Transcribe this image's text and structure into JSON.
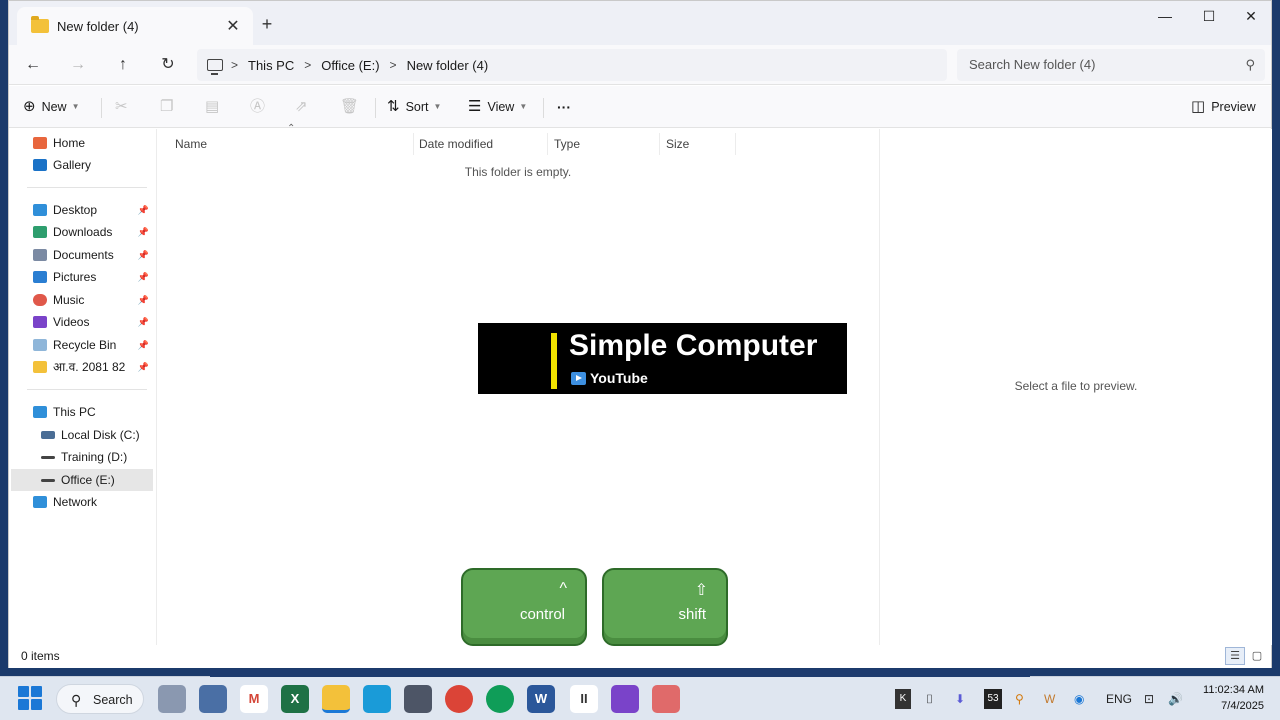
{
  "tab": {
    "title": "New folder (4)",
    "close": "✕",
    "new": "+"
  },
  "window_controls": {
    "minimize": "—",
    "maximize": "☐",
    "close": "✕"
  },
  "nav": {
    "back": "←",
    "forward": "→",
    "up": "↑",
    "refresh": "↻"
  },
  "address": {
    "crumbs": [
      "This PC",
      "Office (E:)",
      "New folder (4)"
    ],
    "sep": ">"
  },
  "search": {
    "placeholder": "Search New folder (4)",
    "icon": "search-icon"
  },
  "toolbar": {
    "new_label": "New",
    "sort_label": "Sort",
    "view_label": "View",
    "more_label": "···",
    "preview_label": "Preview"
  },
  "sidebar": {
    "quick": [
      {
        "label": "Home",
        "color": "#e8663d",
        "pinned": false
      },
      {
        "label": "Gallery",
        "color": "#1a72c7",
        "pinned": false
      }
    ],
    "pinned": [
      {
        "label": "Desktop",
        "color": "#2f8fd9"
      },
      {
        "label": "Downloads",
        "color": "#2e9e6e"
      },
      {
        "label": "Documents",
        "color": "#7b8aa3"
      },
      {
        "label": "Pictures",
        "color": "#2a7ed2"
      },
      {
        "label": "Music",
        "color": "#e0584a"
      },
      {
        "label": "Videos",
        "color": "#7a43c9"
      },
      {
        "label": "Recycle Bin",
        "color": "#8fb6d9"
      },
      {
        "label": "आ.व. 2081 82",
        "color": "#f3c13a"
      }
    ],
    "pc": [
      {
        "label": "This PC",
        "color": "#2f8fd9",
        "indent": false
      },
      {
        "label": "Local Disk (C:)",
        "color": "#4a6d95",
        "indent": true
      },
      {
        "label": "Training (D:)",
        "color": "#444444",
        "indent": true
      },
      {
        "label": "Office (E:)",
        "color": "#444444",
        "indent": true,
        "selected": true
      },
      {
        "label": "Network",
        "color": "#2f8fd9",
        "indent": false
      }
    ]
  },
  "columns": [
    "Name",
    "Date modified",
    "Type",
    "Size"
  ],
  "content": {
    "empty_message": "This folder is empty."
  },
  "preview": {
    "message": "Select a file to preview."
  },
  "status": {
    "items": "0 items"
  },
  "overlay": {
    "channel": "Simple Computer",
    "platform": "YouTube",
    "keys": [
      {
        "label": "control",
        "symbol": "^"
      },
      {
        "label": "shift",
        "symbol": "⇧"
      }
    ]
  },
  "taskbar": {
    "search_label": "Search",
    "lang": "ENG",
    "time": "11:02:34 AM",
    "date": "7/4/2025",
    "badge": "53"
  }
}
